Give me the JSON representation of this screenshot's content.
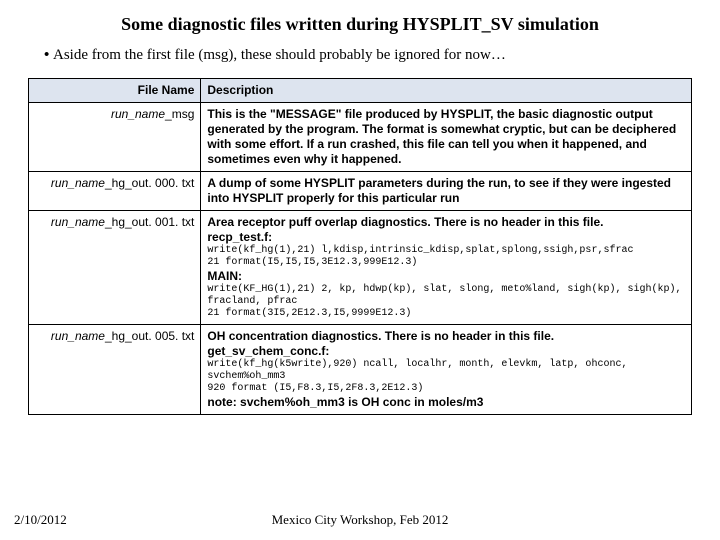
{
  "title": "Some diagnostic files written during HYSPLIT_SV simulation",
  "bullet": "Aside from the first file (msg), these should probably be ignored for now…",
  "headers": {
    "file": "File Name",
    "desc": "Description"
  },
  "rows": [
    {
      "prefix": "run_name",
      "suffix": "_msg",
      "desc_bold": "This is the \"MESSAGE\" file produced by HYSPLIT, the basic diagnostic output generated by the program. The format is somewhat cryptic, but can be deciphered with some effort.  If a run crashed, this file can tell you when it happened, and sometimes even why it happened."
    },
    {
      "prefix": "run_name",
      "suffix": "_hg_out. 000. txt",
      "desc_bold": "A dump of some HYSPLIT parameters during the run, to see if they were ingested into HYSPLIT properly for this particular run"
    },
    {
      "prefix": "run_name",
      "suffix": "_hg_out. 001. txt",
      "line1": "Area receptor puff overlap diagnostics. There is no header in this file.",
      "line2": "recp_test.f:",
      "code1": "write(kf_hg(1),21) l,kdisp,intrinsic_kdisp,splat,splong,ssigh,psr,sfrac\n21 format(I5,I5,I5,3E12.3,999E12.3)",
      "line3": "MAIN:",
      "code2": "write(KF_HG(1),21) 2, kp, hdwp(kp), slat, slong, meto%land, sigh(kp), sigh(kp), fracland, pfrac\n21 format(3I5,2E12.3,I5,9999E12.3)"
    },
    {
      "prefix": "run_name",
      "suffix": "_hg_out. 005. txt",
      "line1": "OH concentration diagnostics. There is no header in this file.",
      "line2": "get_sv_chem_conc.f:",
      "code1": "write(kf_hg(k5write),920) ncall, localhr, month, elevkm, latp, ohconc, svchem%oh_mm3\n920 format (I5,F8.3,I5,2F8.3,2E12.3)",
      "line3": "note: svchem%oh_mm3 is OH conc in moles/m3"
    }
  ],
  "footer": {
    "date": "2/10/2012",
    "center": "Mexico City Workshop, Feb 2012"
  }
}
